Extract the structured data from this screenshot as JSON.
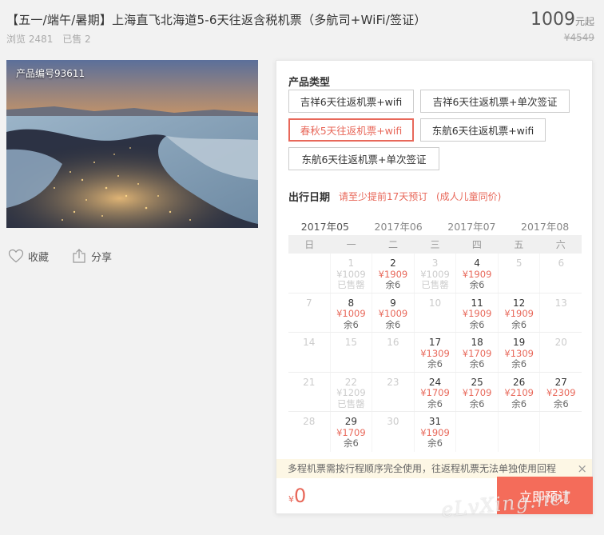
{
  "product": {
    "title": "【五一/端午/暑期】上海直飞北海道5-6天往返含税机票（多航司+WiFi/签证）",
    "views": "浏览 2481",
    "sold": "已售 2",
    "price": "1009",
    "price_unit": "元起",
    "original_price": "¥4549",
    "product_code": "产品编号93611"
  },
  "actions": {
    "favorite": "收藏",
    "share": "分享"
  },
  "booking": {
    "type_label": "产品类型",
    "options": [
      "吉祥6天往返机票+wifi",
      "吉祥6天往返机票+单次签证",
      "春秋5天往返机票+wifi",
      "东航6天往返机票+wifi",
      "东航6天往返机票+单次签证"
    ],
    "selected_option": 2,
    "date_label": "出行日期",
    "advance_hint": "请至少提前17天预订",
    "child_hint": "(成人儿童同价)",
    "months": [
      "2017年05",
      "2017年06",
      "2017年07",
      "2017年08"
    ],
    "weekdays": [
      "日",
      "一",
      "二",
      "三",
      "四",
      "五",
      "六"
    ],
    "calendar": [
      [
        {
          "d": ""
        },
        {
          "d": "1",
          "p": "¥1009",
          "s": "已售罄",
          "st": "sold"
        },
        {
          "d": "2",
          "p": "¥1909",
          "s": "余6"
        },
        {
          "d": "3",
          "p": "¥1009",
          "s": "已售罄",
          "st": "sold"
        },
        {
          "d": "4",
          "p": "¥1909",
          "s": "余6"
        },
        {
          "d": "5",
          "st": "dis"
        },
        {
          "d": "6",
          "st": "dis"
        }
      ],
      [
        {
          "d": "7",
          "st": "dis"
        },
        {
          "d": "8",
          "p": "¥1009",
          "s": "余6"
        },
        {
          "d": "9",
          "p": "¥1009",
          "s": "余6"
        },
        {
          "d": "10",
          "st": "dis"
        },
        {
          "d": "11",
          "p": "¥1909",
          "s": "余6"
        },
        {
          "d": "12",
          "p": "¥1909",
          "s": "余6"
        },
        {
          "d": "13",
          "st": "dis"
        }
      ],
      [
        {
          "d": "14",
          "st": "dis"
        },
        {
          "d": "15",
          "st": "dis"
        },
        {
          "d": "16",
          "st": "dis"
        },
        {
          "d": "17",
          "p": "¥1309",
          "s": "余6"
        },
        {
          "d": "18",
          "p": "¥1709",
          "s": "余6"
        },
        {
          "d": "19",
          "p": "¥1309",
          "s": "余6"
        },
        {
          "d": "20",
          "st": "dis"
        }
      ],
      [
        {
          "d": "21",
          "st": "dis"
        },
        {
          "d": "22",
          "p": "¥1209",
          "s": "已售罄",
          "st": "sold"
        },
        {
          "d": "23",
          "st": "dis"
        },
        {
          "d": "24",
          "p": "¥1709",
          "s": "余6"
        },
        {
          "d": "25",
          "p": "¥1709",
          "s": "余6"
        },
        {
          "d": "26",
          "p": "¥2109",
          "s": "余6"
        },
        {
          "d": "27",
          "p": "¥2309",
          "s": "余6"
        }
      ],
      [
        {
          "d": "28",
          "st": "dis"
        },
        {
          "d": "29",
          "p": "¥1709",
          "s": "余6"
        },
        {
          "d": "30",
          "st": "dis"
        },
        {
          "d": "31",
          "p": "¥1909",
          "s": "余6"
        },
        {
          "d": ""
        },
        {
          "d": ""
        },
        {
          "d": ""
        }
      ]
    ],
    "notice": "多程机票需按行程顺序完全使用，往返程机票无法单独使用回程",
    "close_icon": "×",
    "currency": "¥",
    "total": "0",
    "book_label": "立即预订"
  },
  "watermark": "eLvXing.net",
  "colors": {
    "accent": "#e8685a",
    "button": "#f46c5a"
  }
}
